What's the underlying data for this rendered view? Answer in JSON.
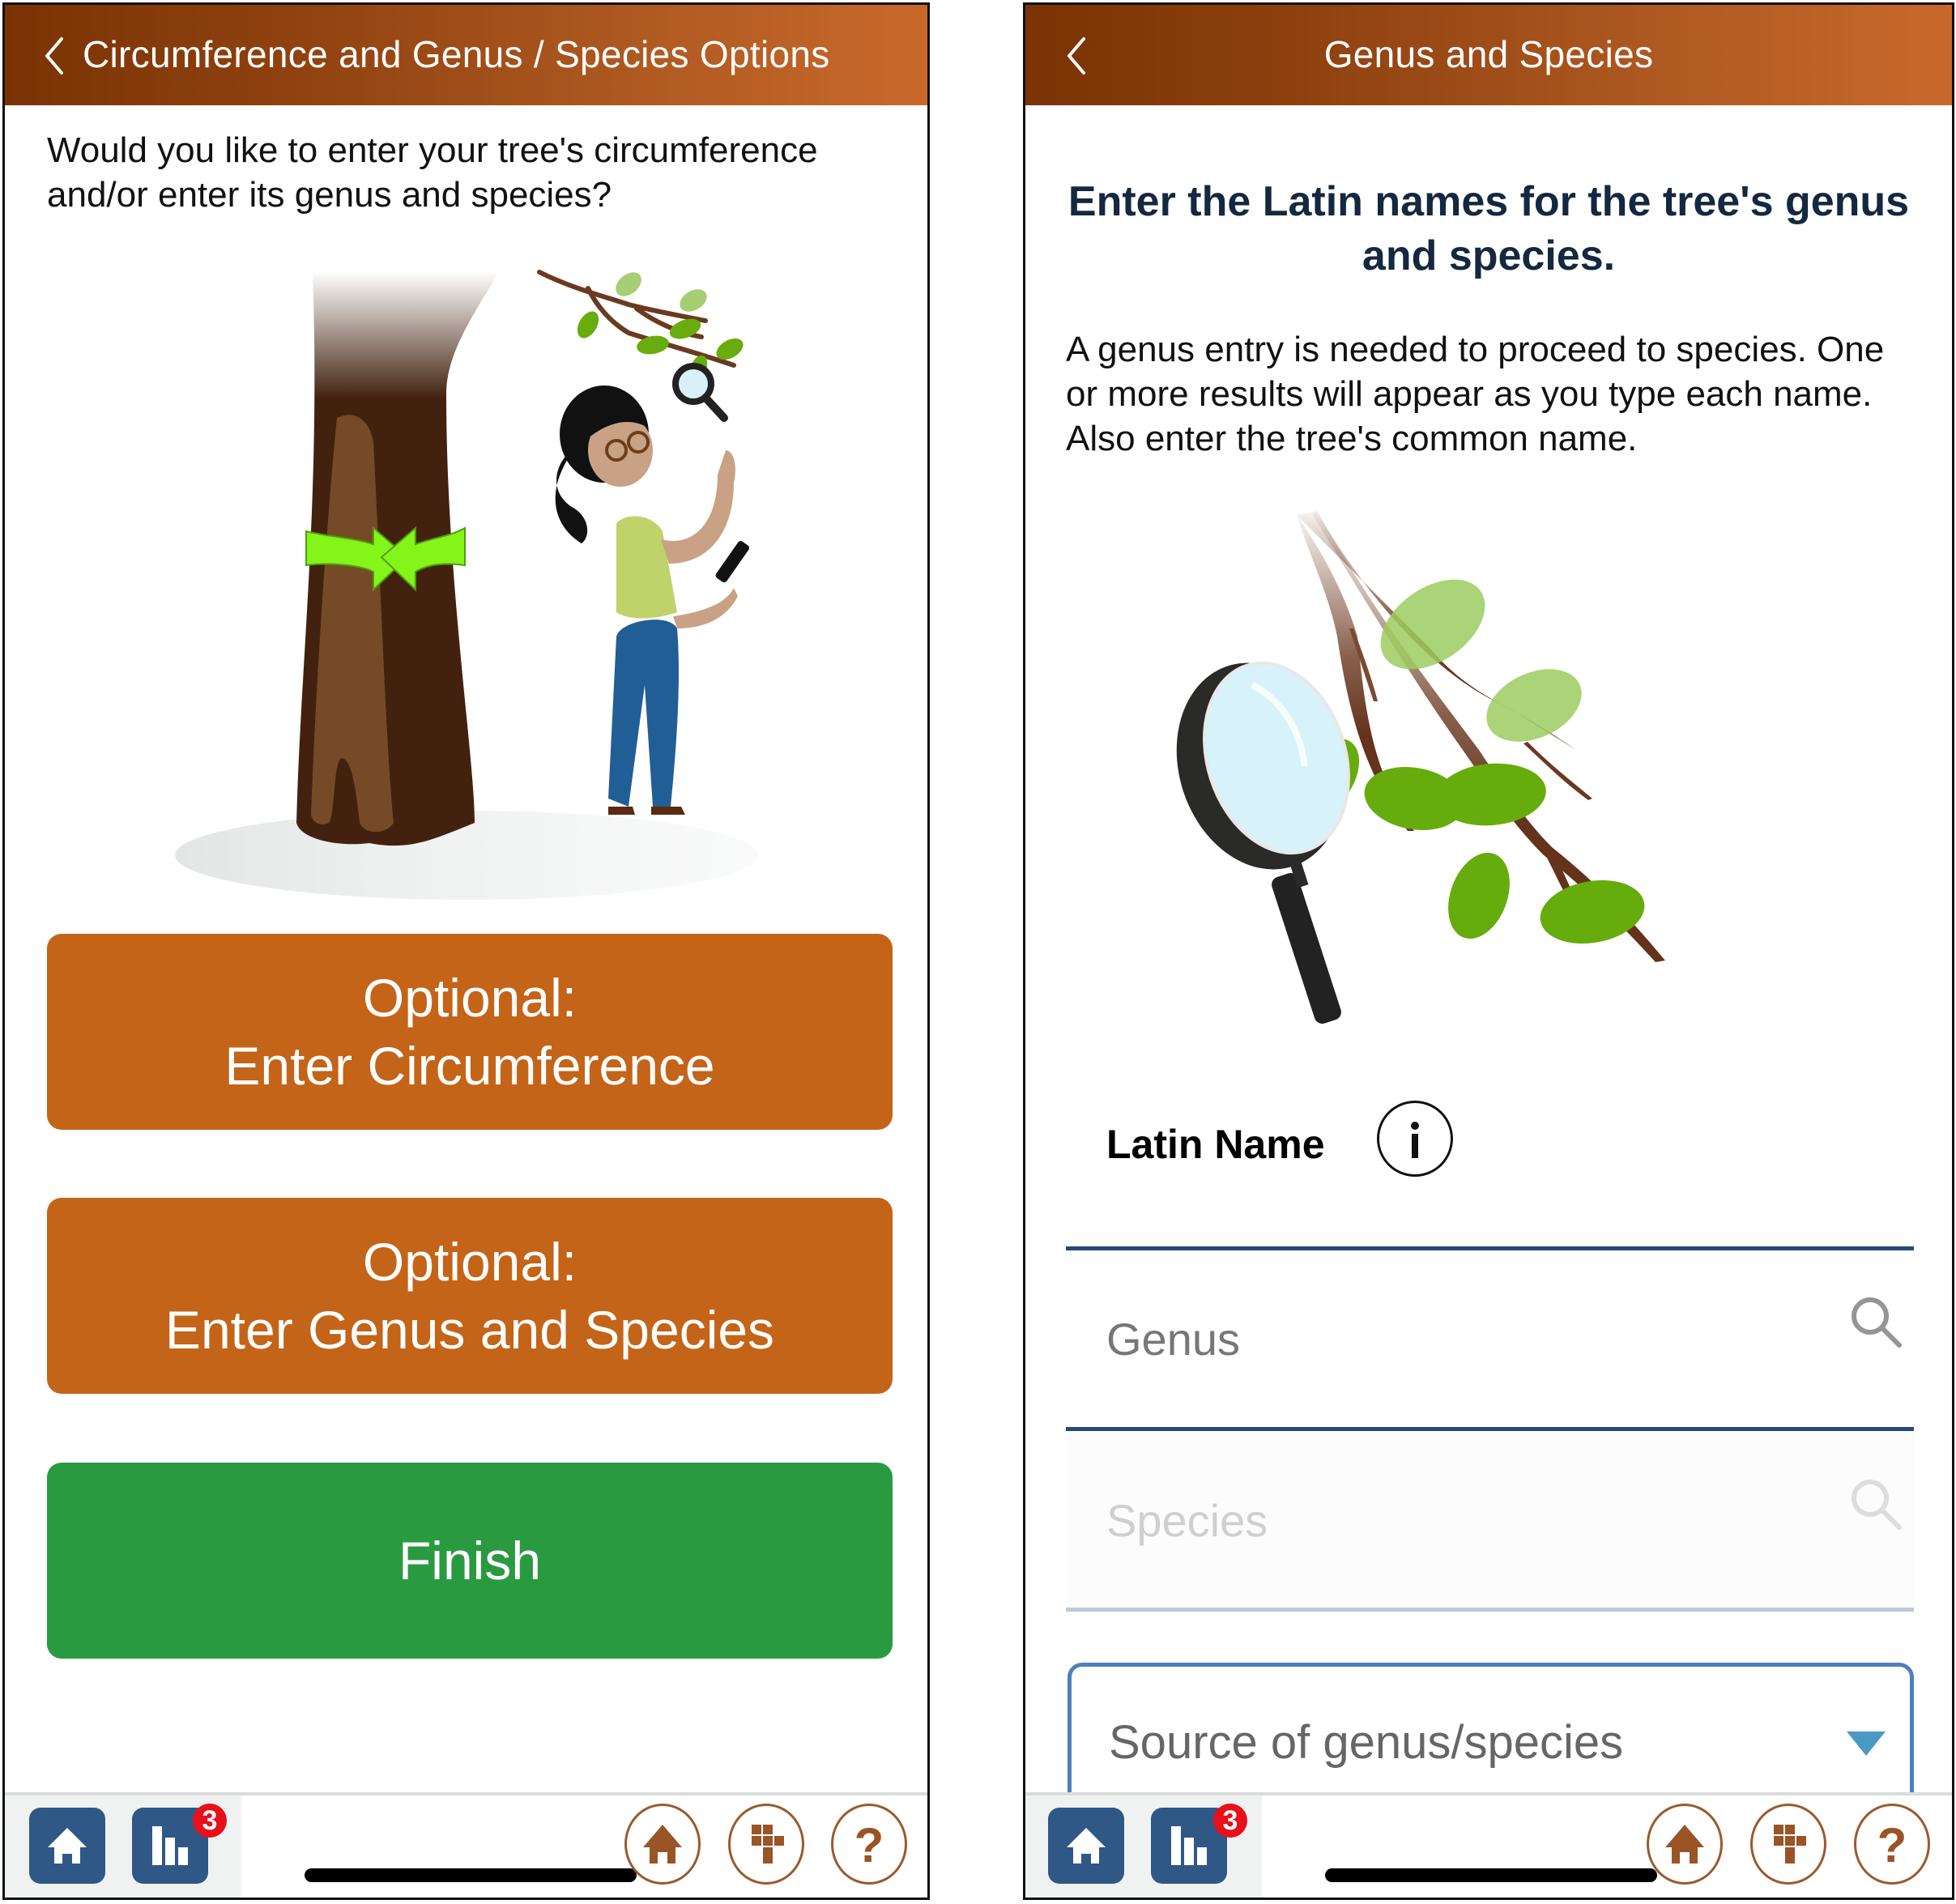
{
  "left_screen": {
    "header": {
      "back_icon": "chevron-left-icon",
      "title": "Circumference and Genus / Species Options"
    },
    "question": "Would you like to enter your tree's circumference and/or enter its genus and species?",
    "illustration": "person-measuring-tree-illustration",
    "buttons": [
      {
        "line1": "Optional:",
        "line2": "Enter Circumference",
        "color": "#c46418"
      },
      {
        "line1": "Optional:",
        "line2": "Enter Genus and Species",
        "color": "#c46418"
      },
      {
        "line1": "Finish",
        "line2": "",
        "color": "#2a9a40"
      }
    ],
    "bottom_bar": {
      "home_icon": "home-icon",
      "stats_icon": "bar-chart-icon",
      "stats_badge": "3",
      "right_icons": [
        "home-icon",
        "grid-icon",
        "help-icon"
      ],
      "help_glyph": "?"
    }
  },
  "right_screen": {
    "header": {
      "back_icon": "chevron-left-icon",
      "title": "Genus and Species"
    },
    "heading": "Enter the Latin names for the tree's genus and species.",
    "body": "A genus entry is needed to proceed to species. One or more results will appear as you type each name. Also enter the tree's common name.",
    "illustration": "magnifier-and-branch-illustration",
    "latin_label": "Latin Name",
    "info_glyph": "i",
    "genus": {
      "placeholder": "Genus",
      "value": ""
    },
    "species": {
      "placeholder": "Species",
      "value": "",
      "disabled": true
    },
    "source_dropdown": {
      "placeholder": "Source of genus/species"
    },
    "bottom_bar": {
      "home_icon": "home-icon",
      "stats_icon": "bar-chart-icon",
      "stats_badge": "3",
      "right_icons": [
        "home-icon",
        "grid-icon",
        "help-icon"
      ],
      "help_glyph": "?"
    }
  },
  "colors": {
    "header_start": "#7a3305",
    "header_end": "#c8692a",
    "dock_blue": "#2f5887",
    "badge_red": "#e8101a",
    "accent_brown": "#9a5a2e",
    "field_line": "#234a78",
    "dropdown_border": "#4d7fbd"
  }
}
